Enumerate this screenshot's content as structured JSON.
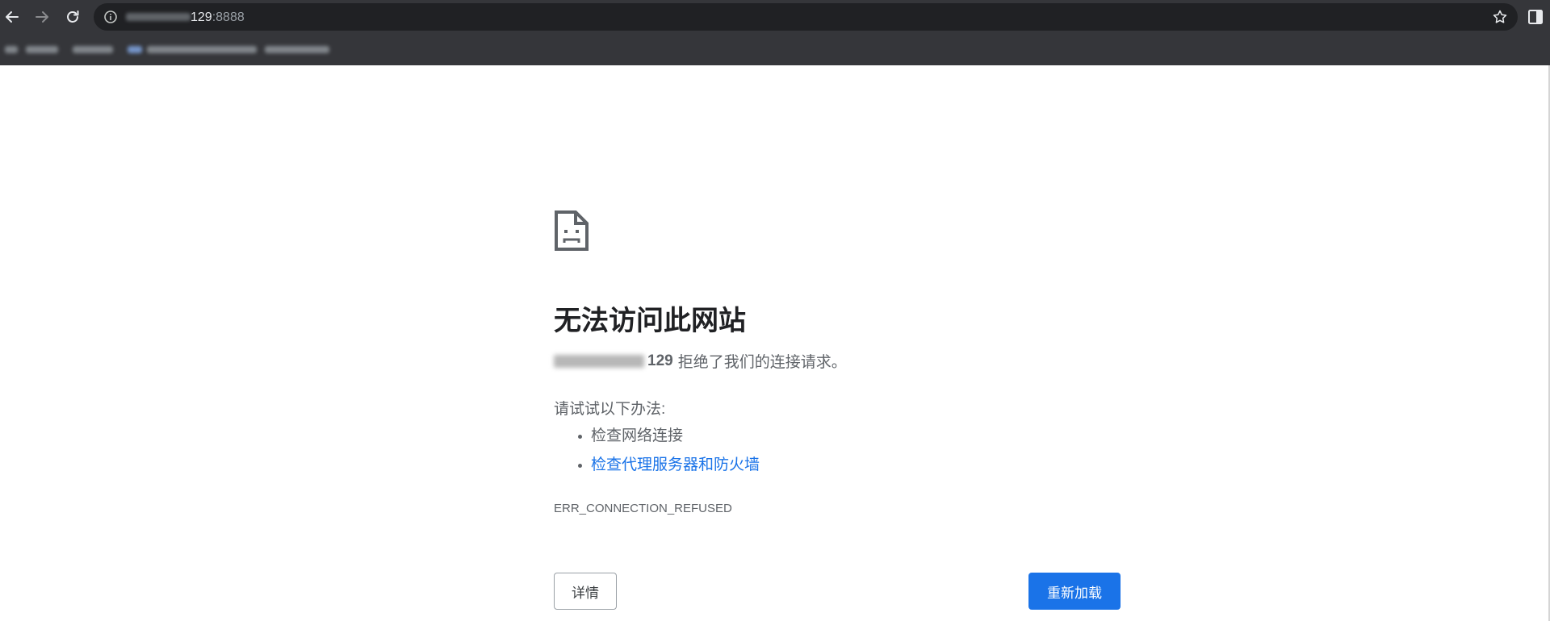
{
  "browser": {
    "url_host_suffix": "129",
    "url_port": ":8888",
    "toolbar_color": "#35363a",
    "omnibox_color": "#202124",
    "icons": [
      "back-arrow-icon",
      "forward-arrow-icon",
      "reload-icon",
      "info-icon",
      "star-icon",
      "side-panel-icon"
    ]
  },
  "error_page": {
    "icon": "sad-page-icon",
    "title": "无法访问此网站",
    "host_suffix": "129",
    "refused_text": "拒绝了我们的连接请求。",
    "suggest_title": "请试试以下办法:",
    "suggestions": [
      {
        "label": "检查网络连接",
        "link": false
      },
      {
        "label": "检查代理服务器和防火墙",
        "link": true
      }
    ],
    "error_code": "ERR_CONNECTION_REFUSED",
    "details_label": "详情",
    "reload_label": "重新加载",
    "accent_color": "#1a73e8"
  }
}
